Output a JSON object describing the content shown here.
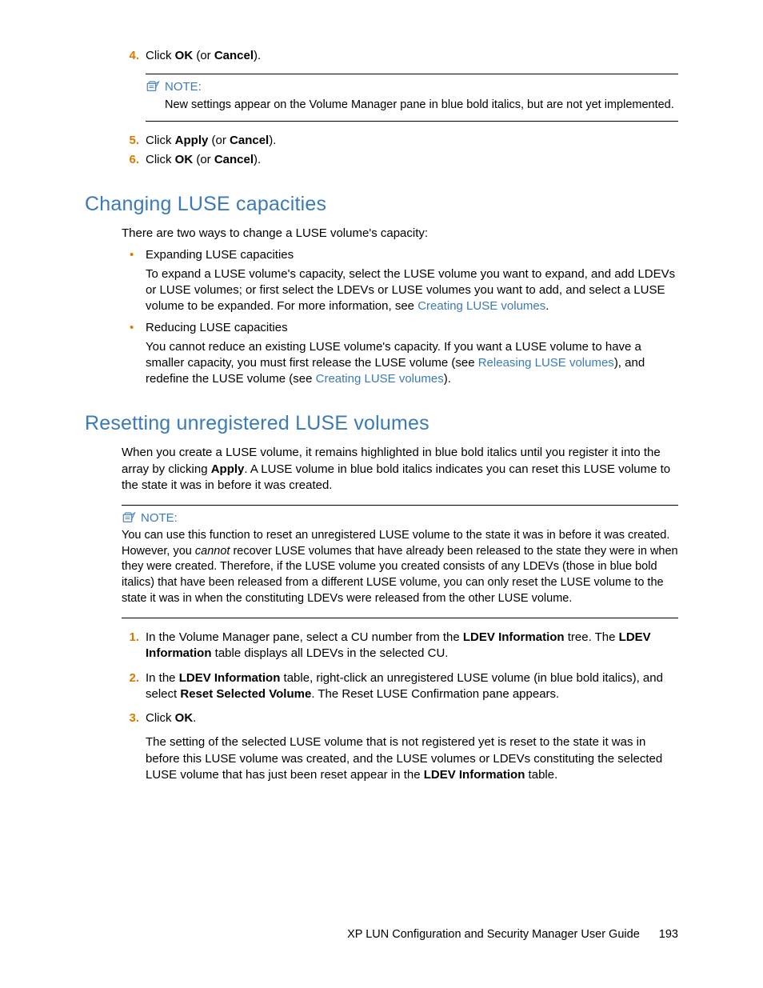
{
  "top_steps": [
    {
      "num": "4.",
      "html": "Click <b>OK</b> (or <b>Cancel</b>)."
    },
    {
      "num": "5.",
      "html": "Click <b>Apply</b> (or <b>Cancel</b>)."
    },
    {
      "num": "6.",
      "html": "Click <b>OK</b> (or <b>Cancel</b>)."
    }
  ],
  "note1": {
    "label": "NOTE:",
    "body": "New settings appear on the Volume Manager pane in blue bold italics, but are not yet implemented."
  },
  "section1": {
    "title": "Changing LUSE capacities",
    "intro": "There are two ways to change a LUSE volume's capacity:",
    "bullets": [
      {
        "head": "Expanding LUSE capacities",
        "body_html": "To expand a LUSE volume's capacity, select the LUSE volume you want to expand, and add LDEVs or LUSE volumes; or first select the LDEVs or LUSE volumes you want to add, and select a LUSE volume to be expanded. For more information, see <a class=\"link\" href=\"#\" data-name=\"link-creating-luse-1\" data-interactable=\"true\">Creating LUSE volumes</a>."
      },
      {
        "head": "Reducing LUSE capacities",
        "body_html": "You cannot reduce an existing LUSE volume's capacity. If you want a LUSE volume to have a smaller capacity, you must first release the LUSE volume (see <a class=\"link\" href=\"#\" data-name=\"link-releasing-luse\" data-interactable=\"true\">Releasing LUSE volumes</a>), and redefine the LUSE volume (see <a class=\"link\" href=\"#\" data-name=\"link-creating-luse-2\" data-interactable=\"true\">Creating LUSE volumes</a>)."
      }
    ]
  },
  "section2": {
    "title": "Resetting unregistered LUSE volumes",
    "intro_html": "When you create a LUSE volume, it remains highlighted in blue bold italics until you register it into the array by clicking <b>Apply</b>. A LUSE volume in blue bold italics indicates you can reset this LUSE volume to the state it was in before it was created."
  },
  "note2": {
    "label": "NOTE:",
    "body_html": "You can use this function to reset an unregistered LUSE volume to the state it was in before it was created. However, you <i>cannot</i> recover LUSE volumes that have already been released to the state they were in when they were created. Therefore, if the LUSE volume you created consists of any LDEVs (those in blue bold italics) that have been released from a different LUSE volume, you can only reset the LUSE volume to the state it was in when the constituting LDEVs were released from the other LUSE volume."
  },
  "bottom_steps": [
    {
      "num": "1.",
      "html": "In the Volume Manager pane, select a CU number from the <b>LDEV Information</b> tree. The <b>LDEV Information</b> table displays all LDEVs in the selected CU."
    },
    {
      "num": "2.",
      "html": "In the <b>LDEV Information</b> table, right-click an unregistered LUSE volume (in blue bold italics), and select <b>Reset Selected Volume</b>. The Reset LUSE Confirmation pane appears."
    },
    {
      "num": "3.",
      "html": "Click <b>OK</b>."
    }
  ],
  "bottom_extra_html": "The setting of the selected LUSE volume that is not registered yet is reset to the state it was in before this LUSE volume was created, and the LUSE volumes or LDEVs constituting the selected LUSE volume that has just been reset appear in the <b>LDEV Information</b> table.",
  "footer": {
    "title": "XP LUN Configuration and Security Manager User Guide",
    "page": "193"
  }
}
